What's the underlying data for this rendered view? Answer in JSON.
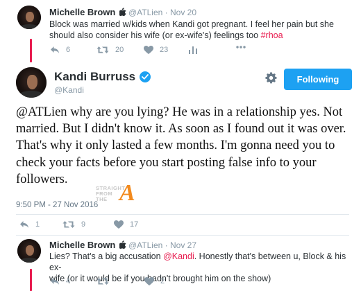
{
  "thread": {
    "colors": {
      "accent": "#e81c4f",
      "link": "#1da1f2",
      "muted": "#8899a6"
    }
  },
  "reply_top": {
    "name": "Michelle Brown",
    "apple_glyph": "",
    "handle": "@ATLien · Nov 20",
    "text_line1": "Block was married w/kids when Kandi got pregnant. I feel her pain but she",
    "text_line2": "should also consider his wife (or ex-wife's) feelings too ",
    "hashtag": "#rhoa",
    "reply_count": "6",
    "retweet_count": "20",
    "like_count": "23",
    "avatar_icon": "avatar"
  },
  "main_tweet": {
    "name": "Kandi Burruss",
    "handle": "@Kandi",
    "follow_label": "Following",
    "mention": "@ATLien",
    "text": " why are you lying? He was in a relationship yes. Not married. But I didn't know it. As soon as I found out it was over. That's why it only lasted a few months. I'm gonna need you to check your facts before you start posting false info to your followers.",
    "timestamp": "9:50 PM - 27 Nov 2016",
    "reply_count": "1",
    "retweet_count": "9",
    "like_count": "17",
    "watermark_line1": "STRAIGHT",
    "watermark_line2": "FROM",
    "watermark_line3": "THE",
    "watermark_letter": "A"
  },
  "reply_bottom": {
    "name": "Michelle Brown",
    "apple_glyph": "",
    "handle": "@ATLien · Nov 27",
    "text_line1_a": "Lies? That's a big accusation ",
    "mention": "@Kandi",
    "text_line1_b": ". Honestly that's between u, Block & his ex-",
    "text_line2": "wife (or it would be if you hadn't brought him on the show)",
    "reply_count": "4",
    "retweet_count": "",
    "like_count": "2"
  }
}
